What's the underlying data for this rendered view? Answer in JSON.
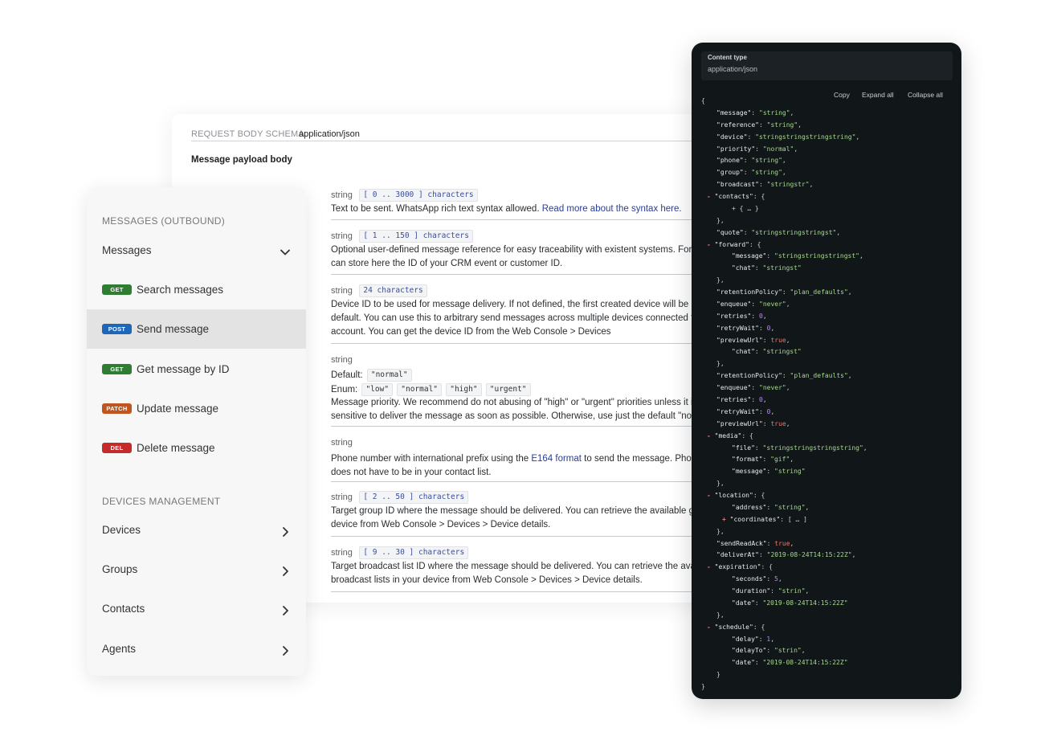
{
  "doc": {
    "schema_key": "REQUEST BODY SCHEMA:",
    "schema_value": "application/json",
    "payload_title": "Message payload body",
    "fields": [
      {
        "type": "string",
        "constraint": "[ 0 .. 3000 ] characters",
        "lines": [
          "Text to be sent. WhatsApp rich text syntax allowed. "
        ],
        "link": "Read more about the syntax here."
      },
      {
        "type": "string",
        "constraint": "[ 1 .. 150 ] characters",
        "lines": [
          "Optional user-defined message reference for easy traceability with existent systems. For",
          "can store here the ID of your CRM event or customer ID."
        ]
      },
      {
        "type": "string",
        "constraint": "24 characters",
        "lines": [
          "Device ID to be used for message delivery. If not defined, the first created device will be u",
          "default. You can use this to arbitrary send messages across multiple devices connected t",
          "account. You can get the device ID from the Web Console > Devices"
        ]
      },
      {
        "type": "string",
        "default_label": "Default:",
        "default_value": "\"normal\"",
        "enum_label": "Enum:",
        "enum_values": [
          "\"low\"",
          "\"normal\"",
          "\"high\"",
          "\"urgent\""
        ],
        "lines": [
          "Message priority. We recommend do not abusing of \"high\" or \"urgent\" priorities unless it is",
          "sensitive to deliver the message as soon as possible. Otherwise, use just the default \"norm"
        ]
      },
      {
        "type": "string",
        "pre": "Phone number with international prefix using the ",
        "link": "E164 format",
        "post": " to send the message. Phon",
        "lines": [
          "does not have to be in your contact list."
        ]
      },
      {
        "type": "string",
        "constraint": "[ 2 .. 50 ] characters",
        "lines": [
          "Target group ID where the message should be delivered. You can retrieve the available gro",
          "device from Web Console > Devices > Device details."
        ]
      },
      {
        "type": "string",
        "constraint": "[ 9 .. 30 ] characters",
        "lines": [
          "Target broadcast list ID where the message should be delivered. You can retrieve the avail",
          "broadcast lists in your device from Web Console > Devices > Device details."
        ]
      }
    ]
  },
  "sidebar": {
    "section1": "MESSAGES (OUTBOUND)",
    "messages_label": "Messages",
    "endpoints": [
      {
        "method": "GET",
        "label": "Search messages",
        "color": "#2e7d32",
        "active": false
      },
      {
        "method": "POST",
        "label": "Send message",
        "color": "#1e66b8",
        "active": true
      },
      {
        "method": "GET",
        "label": "Get message by ID",
        "color": "#2e7d32",
        "active": false
      },
      {
        "method": "PATCH",
        "label": "Update message",
        "color": "#c0561f",
        "active": false
      },
      {
        "method": "DEL",
        "label": "Delete message",
        "color": "#c62b2b",
        "active": false
      }
    ],
    "section2": "DEVICES MANAGEMENT",
    "groups": [
      "Devices",
      "Groups",
      "Contacts",
      "Agents"
    ]
  },
  "code_panel": {
    "content_type_label": "Content type",
    "content_type_value": "application/json",
    "copy_label": "Copy",
    "expand_label": "Expand all",
    "collapse_label": "Collapse all",
    "json_lines": [
      {
        "i": 0,
        "t": "{",
        "k": "p"
      },
      {
        "i": 1,
        "k": "kv",
        "key": "\"message\"",
        "v": "\"string\"",
        "vt": "s"
      },
      {
        "i": 1,
        "k": "kv",
        "key": "\"reference\"",
        "v": "\"string\"",
        "vt": "s"
      },
      {
        "i": 1,
        "k": "kv",
        "key": "\"device\"",
        "v": "\"stringstringstringstring\"",
        "vt": "s"
      },
      {
        "i": 1,
        "k": "kv",
        "key": "\"priority\"",
        "v": "\"normal\"",
        "vt": "s"
      },
      {
        "i": 1,
        "k": "kv",
        "key": "\"phone\"",
        "v": "\"string\"",
        "vt": "s"
      },
      {
        "i": 1,
        "k": "kv",
        "key": "\"group\"",
        "v": "\"string\"",
        "vt": "s"
      },
      {
        "i": 1,
        "k": "kv",
        "key": "\"broadcast\"",
        "v": "\"stringstr\"",
        "vt": "s"
      },
      {
        "i": 1,
        "k": "open",
        "key": "\"contacts\"",
        "v": "{",
        "x": "-"
      },
      {
        "i": 2,
        "t": "+ { … }",
        "k": "p"
      },
      {
        "i": 1,
        "t": "},",
        "k": "p"
      },
      {
        "i": 1,
        "k": "kv",
        "key": "\"quote\"",
        "v": "\"stringstringstringst\"",
        "vt": "s"
      },
      {
        "i": 1,
        "k": "open",
        "key": "\"forward\"",
        "v": "{",
        "x": "-"
      },
      {
        "i": 2,
        "k": "kv",
        "key": "\"message\"",
        "v": "\"stringstringstringst\"",
        "vt": "s"
      },
      {
        "i": 2,
        "k": "kv",
        "key": "\"chat\"",
        "v": "\"stringst\"",
        "vt": "s",
        "last": true
      },
      {
        "i": 1,
        "t": "},",
        "k": "p"
      },
      {
        "i": 1,
        "k": "kv",
        "key": "\"retentionPolicy\"",
        "v": "\"plan_defaults\"",
        "vt": "s"
      },
      {
        "i": 1,
        "k": "kv",
        "key": "\"enqueue\"",
        "v": "\"never\"",
        "vt": "s"
      },
      {
        "i": 1,
        "k": "kv",
        "key": "\"retries\"",
        "v": "0",
        "vt": "n"
      },
      {
        "i": 1,
        "k": "kv",
        "key": "\"retryWait\"",
        "v": "0",
        "vt": "n"
      },
      {
        "i": 1,
        "k": "kv",
        "key": "\"previewUrl\"",
        "v": "true",
        "vt": "b"
      },
      {
        "i": 2,
        "k": "kv",
        "key": "\"chat\"",
        "v": "\"stringst\"",
        "vt": "s",
        "last": true
      },
      {
        "i": 1,
        "t": "},",
        "k": "p"
      },
      {
        "i": 1,
        "k": "kv",
        "key": "\"retentionPolicy\"",
        "v": "\"plan_defaults\"",
        "vt": "s"
      },
      {
        "i": 1,
        "k": "kv",
        "key": "\"enqueue\"",
        "v": "\"never\"",
        "vt": "s"
      },
      {
        "i": 1,
        "k": "kv",
        "key": "\"retries\"",
        "v": "0",
        "vt": "n"
      },
      {
        "i": 1,
        "k": "kv",
        "key": "\"retryWait\"",
        "v": "0",
        "vt": "n"
      },
      {
        "i": 1,
        "k": "kv",
        "key": "\"previewUrl\"",
        "v": "true",
        "vt": "b"
      },
      {
        "i": 1,
        "k": "open",
        "key": "\"media\"",
        "v": "{",
        "x": "-"
      },
      {
        "i": 2,
        "k": "kv",
        "key": "\"file\"",
        "v": "\"stringstringstringstring\"",
        "vt": "s"
      },
      {
        "i": 2,
        "k": "kv",
        "key": "\"format\"",
        "v": "\"gif\"",
        "vt": "s"
      },
      {
        "i": 2,
        "k": "kv",
        "key": "\"message\"",
        "v": "\"string\"",
        "vt": "s",
        "last": true
      },
      {
        "i": 1,
        "t": "},",
        "k": "p"
      },
      {
        "i": 1,
        "k": "open",
        "key": "\"location\"",
        "v": "{",
        "x": "-"
      },
      {
        "i": 2,
        "k": "kv",
        "key": "\"address\"",
        "v": "\"string\"",
        "vt": "s"
      },
      {
        "i": 2,
        "k": "open",
        "key": "\"coordinates\"",
        "v": "[ … ]",
        "x": "+"
      },
      {
        "i": 1,
        "t": "},",
        "k": "p"
      },
      {
        "i": 1,
        "k": "kv",
        "key": "\"sendReadAck\"",
        "v": "true",
        "vt": "b"
      },
      {
        "i": 1,
        "k": "kv",
        "key": "\"deliverAt\"",
        "v": "\"2019-08-24T14:15:22Z\"",
        "vt": "s"
      },
      {
        "i": 1,
        "k": "open",
        "key": "\"expiration\"",
        "v": "{",
        "x": "-"
      },
      {
        "i": 2,
        "k": "kv",
        "key": "\"seconds\"",
        "v": "5",
        "vt": "n"
      },
      {
        "i": 2,
        "k": "kv",
        "key": "\"duration\"",
        "v": "\"strin\"",
        "vt": "s"
      },
      {
        "i": 2,
        "k": "kv",
        "key": "\"date\"",
        "v": "\"2019-08-24T14:15:22Z\"",
        "vt": "s",
        "last": true
      },
      {
        "i": 1,
        "t": "},",
        "k": "p"
      },
      {
        "i": 1,
        "k": "open",
        "key": "\"schedule\"",
        "v": "{",
        "x": "-"
      },
      {
        "i": 2,
        "k": "kv",
        "key": "\"delay\"",
        "v": "1",
        "vt": "n"
      },
      {
        "i": 2,
        "k": "kv",
        "key": "\"delayTo\"",
        "v": "\"strin\"",
        "vt": "s"
      },
      {
        "i": 2,
        "k": "kv",
        "key": "\"date\"",
        "v": "\"2019-08-24T14:15:22Z\"",
        "vt": "s",
        "last": true
      },
      {
        "i": 1,
        "t": "}",
        "k": "p"
      },
      {
        "i": 0,
        "t": "}",
        "k": "p"
      }
    ]
  }
}
